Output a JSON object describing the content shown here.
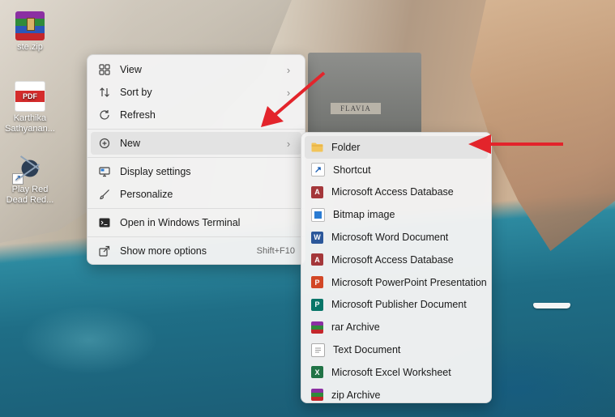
{
  "desktop": {
    "icons": [
      {
        "label": "ste.zip"
      },
      {
        "label": "Karthika Sathyanan..."
      },
      {
        "label": "Play Red Dead Red..."
      }
    ],
    "building_plaque": "FLAVIA"
  },
  "context_menu": {
    "items": [
      {
        "label": "View",
        "icon": "view-icon"
      },
      {
        "label": "Sort by",
        "icon": "sort-icon"
      },
      {
        "label": "Refresh",
        "icon": "refresh-icon"
      },
      {
        "label": "New",
        "icon": "plus-circle-icon"
      },
      {
        "label": "Display settings",
        "icon": "display-icon"
      },
      {
        "label": "Personalize",
        "icon": "brush-icon"
      },
      {
        "label": "Open in Windows Terminal",
        "icon": "terminal-icon"
      },
      {
        "label": "Show more options",
        "icon": "share-icon",
        "shortcut": "Shift+F10"
      }
    ]
  },
  "new_submenu": {
    "items": [
      {
        "label": "Folder",
        "icon": "folder-icon",
        "color": "#f2c45a"
      },
      {
        "label": "Shortcut",
        "icon": "shortcut-icon",
        "color": "#1a5fb4"
      },
      {
        "label": "Microsoft Access Database",
        "icon": "access-icon",
        "color": "#a4373a"
      },
      {
        "label": "Bitmap image",
        "icon": "bitmap-icon",
        "color": "#2b7cd3"
      },
      {
        "label": "Microsoft Word Document",
        "icon": "word-icon",
        "color": "#2b579a"
      },
      {
        "label": "Microsoft Access Database",
        "icon": "access-icon",
        "color": "#a4373a"
      },
      {
        "label": "Microsoft PowerPoint Presentation",
        "icon": "powerpoint-icon",
        "color": "#d24726"
      },
      {
        "label": "Microsoft Publisher Document",
        "icon": "publisher-icon",
        "color": "#077568"
      },
      {
        "label": "rar Archive",
        "icon": "rar-icon",
        "color": "#8b2fa2"
      },
      {
        "label": "Text Document",
        "icon": "text-doc-icon",
        "color": "#9a9a9a"
      },
      {
        "label": "Microsoft Excel Worksheet",
        "icon": "excel-icon",
        "color": "#217346"
      },
      {
        "label": "zip Archive",
        "icon": "zip-icon",
        "color": "#8b2fa2"
      }
    ]
  },
  "colors": {
    "annotation_arrow": "#e3242b",
    "menu_background": "#f3f3f3",
    "hover_highlight": "#e3e3e3"
  }
}
